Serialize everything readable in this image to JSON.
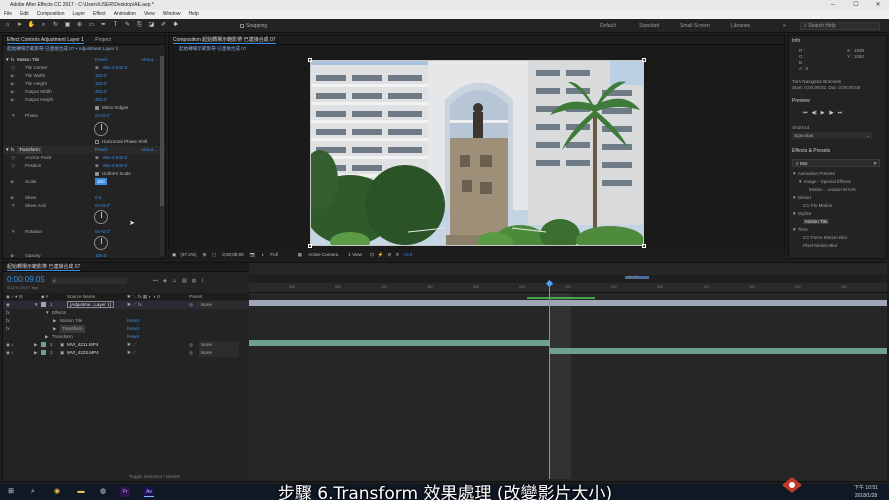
{
  "window": {
    "title": "Adobe After Effects CC 2017 - C:\\Users\\USER\\Desktop\\AE.aep *",
    "controls": [
      "─",
      "☐",
      "✕"
    ]
  },
  "menu": [
    "File",
    "Edit",
    "Composition",
    "Layer",
    "Effect",
    "Animation",
    "View",
    "Window",
    "Help"
  ],
  "toolbar": {
    "snapping_label": "Snapping",
    "workspaces": [
      "Default",
      "Standard",
      "Small Screen",
      "Libraries"
    ],
    "search_placeholder": "Search Help"
  },
  "effect_controls": {
    "tab_label": "Effect Controls Adjustment Layer 1",
    "tab_project": "Project",
    "subtitle": "起始轉場示範影帶 已連接合成 07 • Adjustment Layer 1",
    "motion_tile": {
      "label": "Motion Tile",
      "reset": "Reset",
      "about": "About...",
      "props": [
        {
          "name": "Tile Center",
          "value": "960.0,540.0"
        },
        {
          "name": "Tile Width",
          "value": "100.0"
        },
        {
          "name": "Tile Height",
          "value": "100.0"
        },
        {
          "name": "Output Width",
          "value": "400.0"
        },
        {
          "name": "Output Height",
          "value": "400.0"
        }
      ],
      "mirror_edges": "Mirror Edges",
      "phase": {
        "name": "Phase",
        "value": "0x+0.0°"
      },
      "horizontal_phase_shift": "Horizontal Phase Shift"
    },
    "transform": {
      "label": "Transform",
      "reset": "Reset",
      "about": "About...",
      "anchor_point": {
        "name": "Anchor Point",
        "value": "960.0,540.0"
      },
      "position": {
        "name": "Position",
        "value": "960.0,540.0"
      },
      "uniform_scale": "Uniform Scale",
      "scale": {
        "name": "Scale",
        "value": "100"
      },
      "skew": {
        "name": "Skew",
        "value": "0.0"
      },
      "skew_axis": {
        "name": "Skew Axis",
        "value": "0x+0.0°"
      },
      "rotation": {
        "name": "Rotation",
        "value": "0x+0.0°"
      },
      "opacity": {
        "name": "Opacity",
        "value": "100.0"
      }
    }
  },
  "composition": {
    "tab_label": "Composition 起始轉場示範影帶 已連接合成 07",
    "breadcrumb": "起始轉場示範影帶 已連接合成 07",
    "footer": {
      "zoom": "(37.4%)",
      "timecode": "0;00;09;05",
      "resolution": "Full",
      "camera": "Active Camera",
      "view": "1 View",
      "exposure": "+0.0"
    }
  },
  "right_panel": {
    "info": {
      "title": "Info",
      "r": "R :",
      "g": "G :",
      "b": "B :",
      "a": "A : 0",
      "x": "X : 1939",
      "y": "Y : 1082",
      "nav_line1": "Trim Navigator Brackets",
      "nav_line2": "Start: 0;00;09;02, Dur: 0;00;00;05"
    },
    "preview": {
      "title": "Preview",
      "buttons": [
        "⏮",
        "◀|",
        "▶",
        "|▶",
        "⏭"
      ]
    },
    "shortcut": {
      "title": "Shortcut",
      "value": "Spacebar"
    },
    "effects_presets": {
      "title": "Effects & Presets",
      "search_value": "Mot",
      "items": [
        {
          "label": "▼ Animation Presets",
          "level": 0
        },
        {
          "label": "▼ Image - Special Effects",
          "level": 1
        },
        {
          "label": "Motion ...uration Errors",
          "level": 2
        },
        {
          "label": "▼ Distort",
          "level": 0
        },
        {
          "label": "CC Flo Motion",
          "level": 1
        },
        {
          "label": "▼ Stylize",
          "level": 0
        },
        {
          "label": "Motion Tile",
          "level": 1,
          "selected": true
        },
        {
          "label": "▼ Time",
          "level": 0
        },
        {
          "label": "CC Force Motion Blur",
          "level": 1
        },
        {
          "label": "Pixel Motion Blur",
          "level": 1
        }
      ]
    }
  },
  "timeline": {
    "tab_label": "起始轉場示範影帶 已連接合成 07",
    "timecode": "0:00:09:05",
    "frame_info": "00275 (29.97 fps)",
    "search_placeholder": "ρ·",
    "columns": {
      "source_name": "Source Name",
      "parent": "Parent"
    },
    "ruler_ticks": [
      "04f",
      "08f",
      "12f",
      "16f",
      "20f",
      "24f",
      "09f",
      "04f",
      "08f",
      "12f",
      "16f",
      "20f",
      "24f"
    ],
    "ruler_label": "10:00f",
    "layers": [
      {
        "num": "1",
        "name": "[Adjustme...Layer 1]",
        "parent": "None"
      },
      {
        "num": "2",
        "name": "MVI_4211.MP4",
        "parent": "None"
      },
      {
        "num": "3",
        "name": "MVI_4223.MP4",
        "parent": "None"
      }
    ],
    "sub_rows": [
      {
        "label": "Effects",
        "indent": 1,
        "reset": ""
      },
      {
        "label": "Motion Tile",
        "indent": 2,
        "reset": "Reset"
      },
      {
        "label": "Transform",
        "indent": 2,
        "reset": "Reset"
      },
      {
        "label": "Transform",
        "indent": 1,
        "reset": "Reset"
      }
    ],
    "toggle_label": "Toggle Switches / Modes"
  },
  "taskbar": {
    "time": "下午 10:51",
    "date": "2018/1/28"
  },
  "subtitle": "步驟 6.Transform 效果處理 (改變影片大小)",
  "colors": {
    "accent_blue": "#3b8ee0",
    "playhead": "#4da0ff",
    "layer_bar_adjust": "#9fa6b8",
    "layer_bar_video": "#6fa08f"
  }
}
